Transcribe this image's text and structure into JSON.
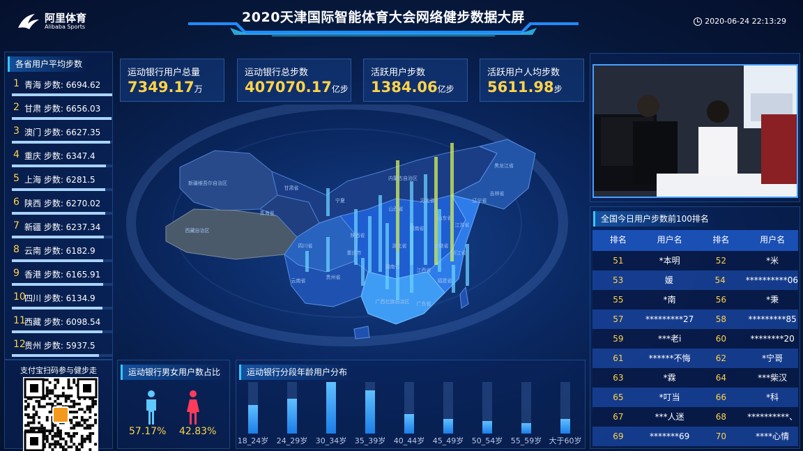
{
  "header": {
    "logo_cn": "阿里体育",
    "logo_en": "Alibaba Sports",
    "title": "2020天津国际智能体育大会网络健步数据大屏",
    "datetime": "2020-06-24 22:13:29"
  },
  "province_panel": {
    "title": "各省用户平均步数",
    "items": [
      {
        "rank": "1",
        "text": "青海 步数: 6694.62",
        "level": 1.0
      },
      {
        "rank": "2",
        "text": "甘肃 步数: 6656.03",
        "level": 0.99
      },
      {
        "rank": "3",
        "text": "澳门 步数: 6627.35",
        "level": 0.98
      },
      {
        "rank": "4",
        "text": "重庆 步数: 6347.4",
        "level": 0.94
      },
      {
        "rank": "5",
        "text": "上海 步数: 6281.5",
        "level": 0.93
      },
      {
        "rank": "6",
        "text": "陕西 步数: 6270.02",
        "level": 0.93
      },
      {
        "rank": "7",
        "text": "新疆 步数: 6237.34",
        "level": 0.92
      },
      {
        "rank": "8",
        "text": "云南 步数: 6182.9",
        "level": 0.91
      },
      {
        "rank": "9",
        "text": "香港 步数: 6165.91",
        "level": 0.91
      },
      {
        "rank": "10",
        "text": "四川 步数: 6134.9",
        "level": 0.9
      },
      {
        "rank": "11",
        "text": "西藏 步数: 6098.54",
        "level": 0.9
      },
      {
        "rank": "12",
        "text": "贵州 步数: 5937.5",
        "level": 0.87
      }
    ]
  },
  "qr": {
    "title": "支付宝扫码参与健步走"
  },
  "kpis": [
    {
      "label": "运动银行用户总量",
      "value": "7349.17",
      "unit": "万"
    },
    {
      "label": "运动银行总步数",
      "value": "407070.17",
      "unit": "亿步"
    },
    {
      "label": "活跃用户步数",
      "value": "1384.06",
      "unit": "亿步"
    },
    {
      "label": "活跃用户人均步数",
      "value": "5611.98",
      "unit": "步"
    }
  ],
  "gender": {
    "title": "运动银行男女用户数占比",
    "male_pct": "57.17%",
    "female_pct": "42.83%",
    "male_color": "#5ec8ff",
    "female_color": "#ff3b5c"
  },
  "age": {
    "title": "运动银行分段年龄用户分布",
    "groups": [
      {
        "label": "18_24岁",
        "level": 0.55
      },
      {
        "label": "24_29岁",
        "level": 0.68
      },
      {
        "label": "30_34岁",
        "level": 1.0
      },
      {
        "label": "35_39岁",
        "level": 0.84
      },
      {
        "label": "40_44岁",
        "level": 0.38
      },
      {
        "label": "45_49岁",
        "level": 0.29
      },
      {
        "label": "50_54岁",
        "level": 0.24
      },
      {
        "label": "55_59岁",
        "level": 0.2
      },
      {
        "label": "大于60岁",
        "level": 0.28
      }
    ]
  },
  "map": {
    "labels": [
      "新疆维吾尔自治区",
      "西藏自治区",
      "青海省",
      "甘肃省",
      "四川省",
      "云南省",
      "内蒙古自治区",
      "黑龙江省",
      "吉林省",
      "辽宁省",
      "河北省",
      "山西省",
      "陕西省",
      "河南省",
      "山东省",
      "湖北省",
      "湖南省",
      "贵州省",
      "广西壮族自治区",
      "广东省",
      "江西省",
      "安徽省",
      "江苏省",
      "浙江省",
      "福建省",
      "重庆市",
      "宁夏"
    ]
  },
  "ranking": {
    "title": "全国今日用户步数前100排名",
    "headers": [
      "排名",
      "用户名",
      "排名",
      "用户名"
    ],
    "rows": [
      [
        "51",
        "*本明",
        "52",
        "*米"
      ],
      [
        "53",
        "媛",
        "54",
        "**********06"
      ],
      [
        "55",
        "*南",
        "56",
        "*秉"
      ],
      [
        "57",
        "*********27",
        "58",
        "*********85"
      ],
      [
        "59",
        "***老i",
        "60",
        "********20"
      ],
      [
        "61",
        "******不悔",
        "62",
        "*宁哥"
      ],
      [
        "63",
        "*霖",
        "64",
        "***柴汉"
      ],
      [
        "65",
        "*叮当",
        "66",
        "*科"
      ],
      [
        "67",
        "***人迷",
        "68",
        "**********、"
      ],
      [
        "69",
        "*******69",
        "70",
        "****心情"
      ]
    ]
  }
}
